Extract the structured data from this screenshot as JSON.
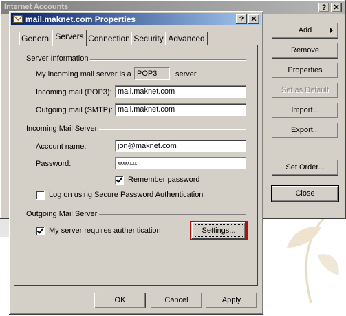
{
  "outer_window": {
    "title": "Internet Accounts",
    "help_label": "?",
    "close_label": "✕",
    "buttons": {
      "add": "Add",
      "remove": "Remove",
      "properties": "Properties",
      "set_as_default": "Set as Default",
      "import": "Import...",
      "export": "Export...",
      "set_order": "Set Order...",
      "close": "Close"
    }
  },
  "dialog": {
    "title": "mail.maknet.com Properties",
    "help_label": "?",
    "close_label": "✕",
    "tabs": [
      "General",
      "Servers",
      "Connection",
      "Security",
      "Advanced"
    ],
    "active_tab": "Servers",
    "server_info": {
      "group_label": "Server Information",
      "incoming_prefix": "My incoming mail server is a",
      "server_type": "POP3",
      "incoming_suffix": "server.",
      "incoming_label": "Incoming mail (POP3):",
      "incoming_value": "mail.maknet.com",
      "outgoing_label": "Outgoing mail (SMTP):",
      "outgoing_value": "mail.maknet.com"
    },
    "incoming_server": {
      "group_label": "Incoming Mail Server",
      "account_label": "Account name:",
      "account_value": "jon@maknet.com",
      "password_label": "Password:",
      "password_value": "xxxxxxxx",
      "remember_label": "Remember password",
      "remember_checked": true,
      "spa_label": "Log on using Secure Password Authentication",
      "spa_checked": false
    },
    "outgoing_server": {
      "group_label": "Outgoing Mail Server",
      "auth_label": "My server requires authentication",
      "auth_checked": true,
      "settings_label": "Settings..."
    },
    "footer": {
      "ok": "OK",
      "cancel": "Cancel",
      "apply": "Apply"
    }
  },
  "colors": {
    "title_active": "#0a246a",
    "title_inactive": "#808080",
    "face": "#d4d0c8",
    "highlight_box": "#d00000"
  }
}
